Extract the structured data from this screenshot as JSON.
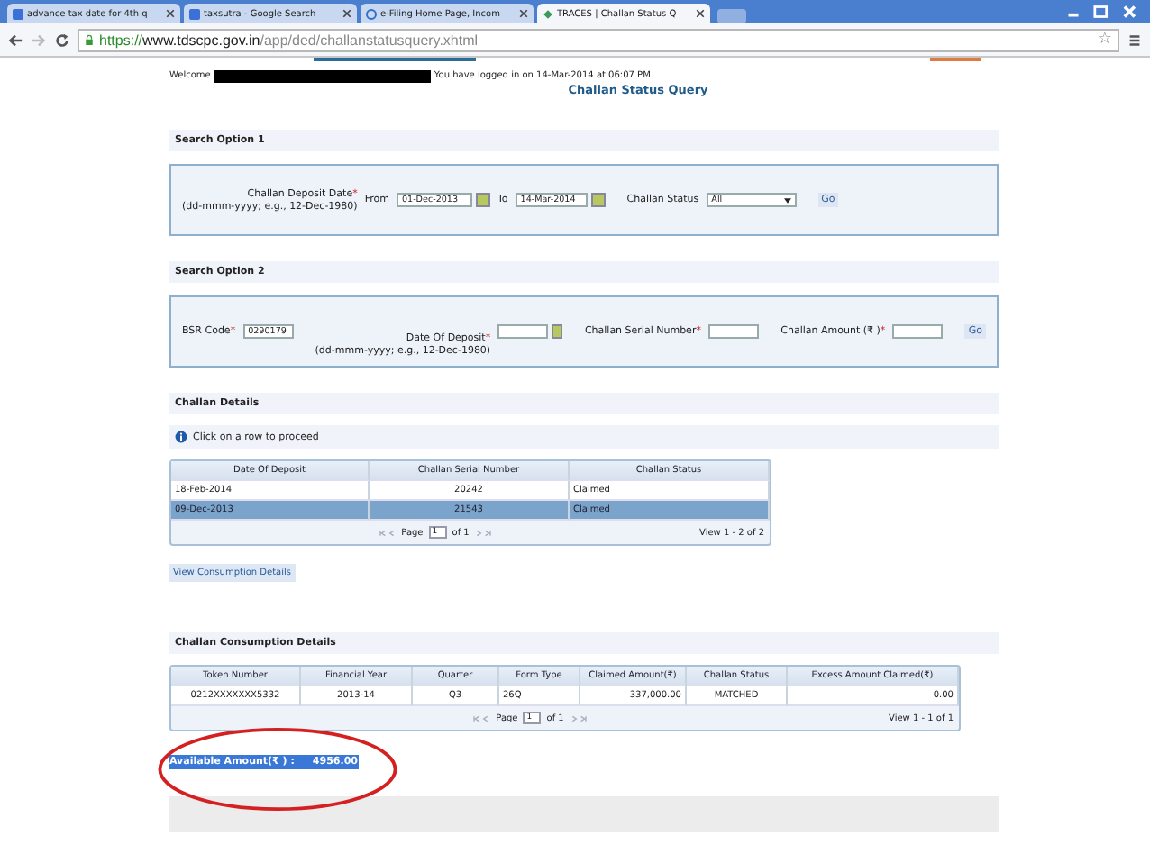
{
  "browser": {
    "tabs": [
      {
        "title": "advance tax date for 4th q",
        "selected": false
      },
      {
        "title": "taxsutra - Google Search",
        "selected": false
      },
      {
        "title": "e-Filing Home Page, Incom",
        "selected": false
      },
      {
        "title": "TRACES | Challan Status Q",
        "selected": true
      }
    ],
    "star": "☆",
    "url_scheme": "https://",
    "url_host": "www.tdscpc.gov.in",
    "url_path": "/app/ded/challanstatusquery.xhtml"
  },
  "header": {
    "welcome": "Welcome",
    "login_info": "You have logged in on 14-Mar-2014 at 06:07 PM",
    "title": "Challan Status Query"
  },
  "search_option_1": {
    "heading": "Search Option 1",
    "required_mark": "*",
    "label": "Challan Deposit Date",
    "hint": "(dd-mmm-yyyy; e.g., 12-Dec-1980)",
    "from_label": "From",
    "from_value": "01-Dec-2013",
    "to_label": "To",
    "to_value": "14-Mar-2014",
    "status_label": "Challan Status",
    "status_value": "All",
    "go": "Go"
  },
  "search_option_2": {
    "heading": "Search Option 2",
    "required_mark": "*",
    "bsr_label": "BSR Code",
    "bsr_value": "0290179",
    "date_label": "Date Of Deposit",
    "date_hint": "(dd-mmm-yyyy; e.g., 12-Dec-1980)",
    "serial_label": "Challan Serial Number",
    "amount_label": "Challan Amount (₹ )",
    "go": "Go"
  },
  "challan_details": {
    "heading": "Challan Details",
    "info": "Click on a row to proceed",
    "columns": [
      "Date Of Deposit",
      "Challan Serial Number",
      "Challan Status"
    ],
    "rows": [
      {
        "cells": [
          "18-Feb-2014",
          "20242",
          "Claimed"
        ],
        "selected": false
      },
      {
        "cells": [
          "09-Dec-2013",
          "21543",
          "Claimed"
        ],
        "selected": true
      }
    ],
    "page_label": "Page",
    "page_value": "1",
    "page_of": "of 1",
    "view": "View 1 - 2 of 2",
    "button": "View Consumption Details"
  },
  "consumption": {
    "heading": "Challan Consumption Details",
    "columns": [
      "Token Number",
      "Financial Year",
      "Quarter",
      "Form Type",
      "Claimed Amount(₹)",
      "Challan Status",
      "Excess Amount Claimed(₹)"
    ],
    "rows": [
      [
        "0212XXXXXXX5332",
        "2013-14",
        "Q3",
        "26Q",
        "337,000.00",
        "MATCHED",
        "0.00"
      ]
    ],
    "page_label": "Page",
    "page_value": "1",
    "page_of": "of 1",
    "view": "View 1 - 1 of 1",
    "available_label": "Available Amount(₹ ) :",
    "available_value": "4956.00"
  }
}
